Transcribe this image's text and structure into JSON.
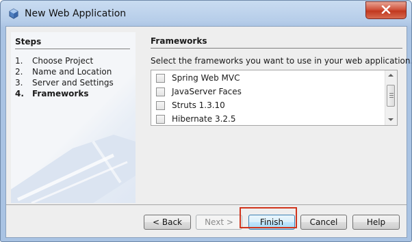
{
  "window": {
    "title": "New Web Application",
    "close_icon": "close-x-icon",
    "app_icon": "netbeans-cube-icon"
  },
  "steps": {
    "heading": "Steps",
    "items": [
      {
        "num": "1.",
        "label": "Choose Project",
        "active": false
      },
      {
        "num": "2.",
        "label": "Name and Location",
        "active": false
      },
      {
        "num": "3.",
        "label": "Server and Settings",
        "active": false
      },
      {
        "num": "4.",
        "label": "Frameworks",
        "active": true
      }
    ]
  },
  "frameworks": {
    "heading": "Frameworks",
    "description": "Select the frameworks you want to use in your web application.",
    "items": [
      {
        "label": "Spring Web MVC",
        "checked": false
      },
      {
        "label": "JavaServer Faces",
        "checked": false
      },
      {
        "label": "Struts 1.3.10",
        "checked": false
      },
      {
        "label": "Hibernate 3.2.5",
        "checked": false
      }
    ]
  },
  "buttons": {
    "back": "< Back",
    "next": "Next >",
    "finish": "Finish",
    "cancel": "Cancel",
    "help": "Help"
  },
  "colors": {
    "highlight": "#d0341c",
    "title_bar": "#b6cde9",
    "close": "#c2381f"
  }
}
